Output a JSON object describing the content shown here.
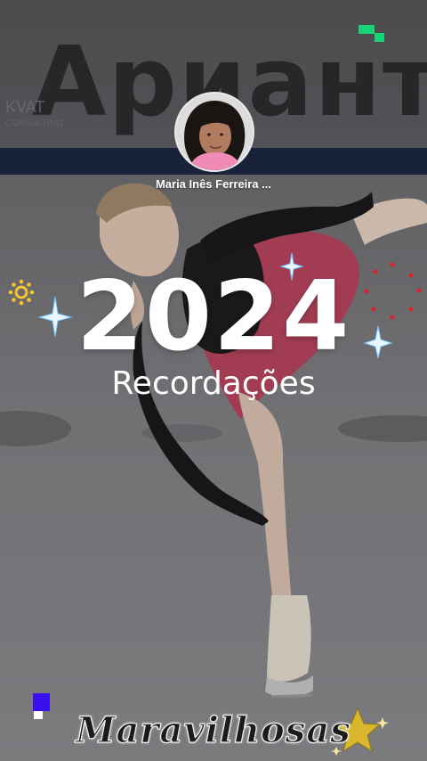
{
  "background": {
    "banner_text": "Ариант",
    "sponsor_text": "KVAT",
    "sponsor_sub": "CONSULTING",
    "rink_stripe_color": "#1c2740"
  },
  "profile": {
    "owner_name": "Maria Inês Ferreira ...",
    "avatar_icon": "profile-photo"
  },
  "overlay": {
    "year": "2024",
    "subtitle": "Recordações",
    "sticker_text": "Maravilhosas"
  },
  "decorations": {
    "sparkle_color": "#e9f6ff",
    "sparkle_glow": "#79c7ff",
    "sun_color": "#f4c430",
    "dots_color": "#e01f2a",
    "star_color": "#d9b62c",
    "pixel_green": "#19d477",
    "pixel_blue": "#3a10ee"
  }
}
